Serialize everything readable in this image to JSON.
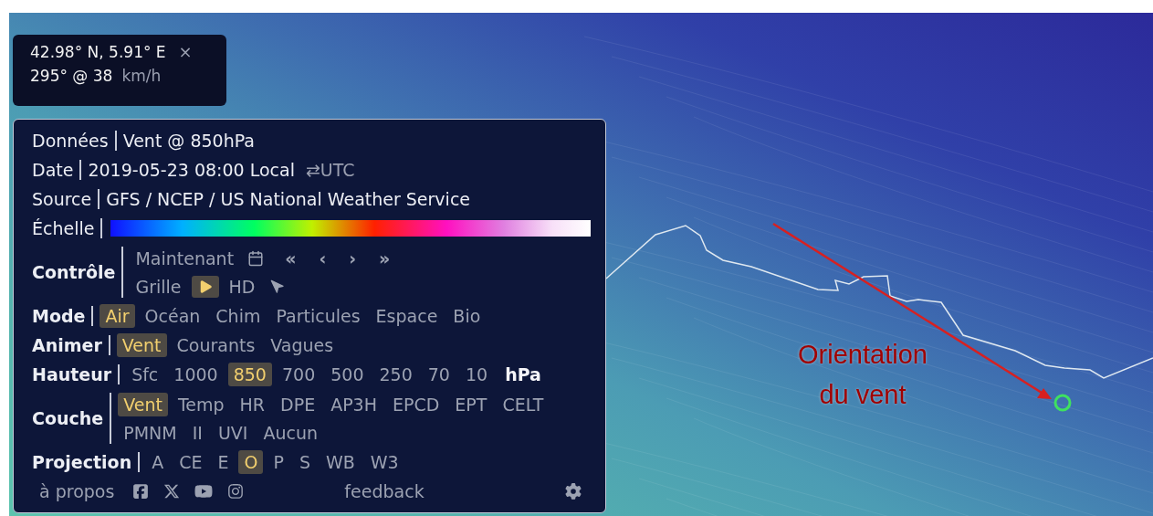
{
  "location": {
    "coords": "42.98° N, 5.91° E",
    "close": "×",
    "wind": "295° @ 38",
    "unit": "km/h"
  },
  "info": [
    {
      "label": "Données",
      "value": "Vent @ 850hPa"
    },
    {
      "label": "Date",
      "value": "2019-05-23 08:00 Local",
      "toggle": "⇄UTC"
    },
    {
      "label": "Source",
      "value": "GFS / NCEP / US National Weather Service"
    }
  ],
  "scale": {
    "label": "Échelle"
  },
  "control": {
    "label": "Contrôle",
    "now": "Maintenant",
    "nav": [
      "«",
      "‹",
      "›",
      "»"
    ],
    "grid": "Grille",
    "play": {
      "selected": true
    },
    "hd": "HD"
  },
  "option_rows": [
    {
      "label": "Mode",
      "lines": [
        [
          {
            "text": "Air",
            "selected": true
          },
          {
            "text": "Océan",
            "selected": false
          },
          {
            "text": "Chim",
            "selected": false
          },
          {
            "text": "Particules",
            "selected": false
          },
          {
            "text": "Espace",
            "selected": false
          },
          {
            "text": "Bio",
            "selected": false
          }
        ]
      ]
    },
    {
      "label": "Animer",
      "lines": [
        [
          {
            "text": "Vent",
            "selected": true
          },
          {
            "text": "Courants",
            "selected": false
          },
          {
            "text": "Vagues",
            "selected": false
          }
        ]
      ]
    },
    {
      "label": "Hauteur",
      "unit": "hPa",
      "lines": [
        [
          {
            "text": "Sfc",
            "selected": false
          },
          {
            "text": "1000",
            "selected": false
          },
          {
            "text": "850",
            "selected": true
          },
          {
            "text": "700",
            "selected": false
          },
          {
            "text": "500",
            "selected": false
          },
          {
            "text": "250",
            "selected": false
          },
          {
            "text": "70",
            "selected": false
          },
          {
            "text": "10",
            "selected": false
          }
        ]
      ]
    },
    {
      "label": "Couche",
      "lines": [
        [
          {
            "text": "Vent",
            "selected": true
          },
          {
            "text": "Temp",
            "selected": false
          },
          {
            "text": "HR",
            "selected": false
          },
          {
            "text": "DPE",
            "selected": false
          },
          {
            "text": "AP3H",
            "selected": false
          },
          {
            "text": "EPCD",
            "selected": false
          },
          {
            "text": "EPT",
            "selected": false
          },
          {
            "text": "CELT",
            "selected": false
          }
        ],
        [
          {
            "text": "PMNM",
            "selected": false
          },
          {
            "text": "II",
            "selected": false
          },
          {
            "text": "UVI",
            "selected": false
          },
          {
            "text": "Aucun",
            "selected": false
          }
        ]
      ]
    },
    {
      "label": "Projection",
      "lines": [
        [
          {
            "text": "A",
            "selected": false
          },
          {
            "text": "CE",
            "selected": false
          },
          {
            "text": "E",
            "selected": false
          },
          {
            "text": "O",
            "selected": true
          },
          {
            "text": "P",
            "selected": false
          },
          {
            "text": "S",
            "selected": false
          },
          {
            "text": "WB",
            "selected": false
          },
          {
            "text": "W3",
            "selected": false
          }
        ]
      ]
    }
  ],
  "footer": {
    "about": "à propos",
    "feedback": "feedback"
  },
  "annotation": {
    "text": "Orientation du vent"
  }
}
